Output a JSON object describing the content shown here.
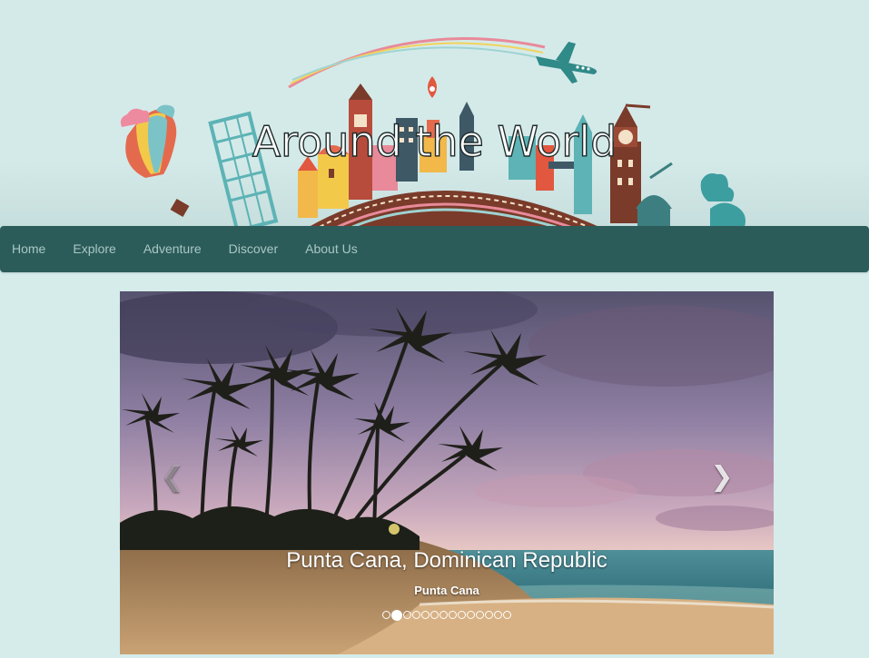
{
  "header": {
    "title": "Around the World"
  },
  "nav": {
    "items": [
      "Home",
      "Explore",
      "Adventure",
      "Discover",
      "About Us"
    ]
  },
  "carousel": {
    "slide_title": "Punta Cana, Dominican Republic",
    "slide_subtitle": "Punta Cana",
    "slide_count": 14,
    "active_index": 1,
    "prev_icon": "chevron-left-icon",
    "next_icon": "chevron-right-icon"
  },
  "colors": {
    "background": "#d5eceb",
    "navbar": "#2b5c5a",
    "nav_text": "#a9c7c4"
  }
}
